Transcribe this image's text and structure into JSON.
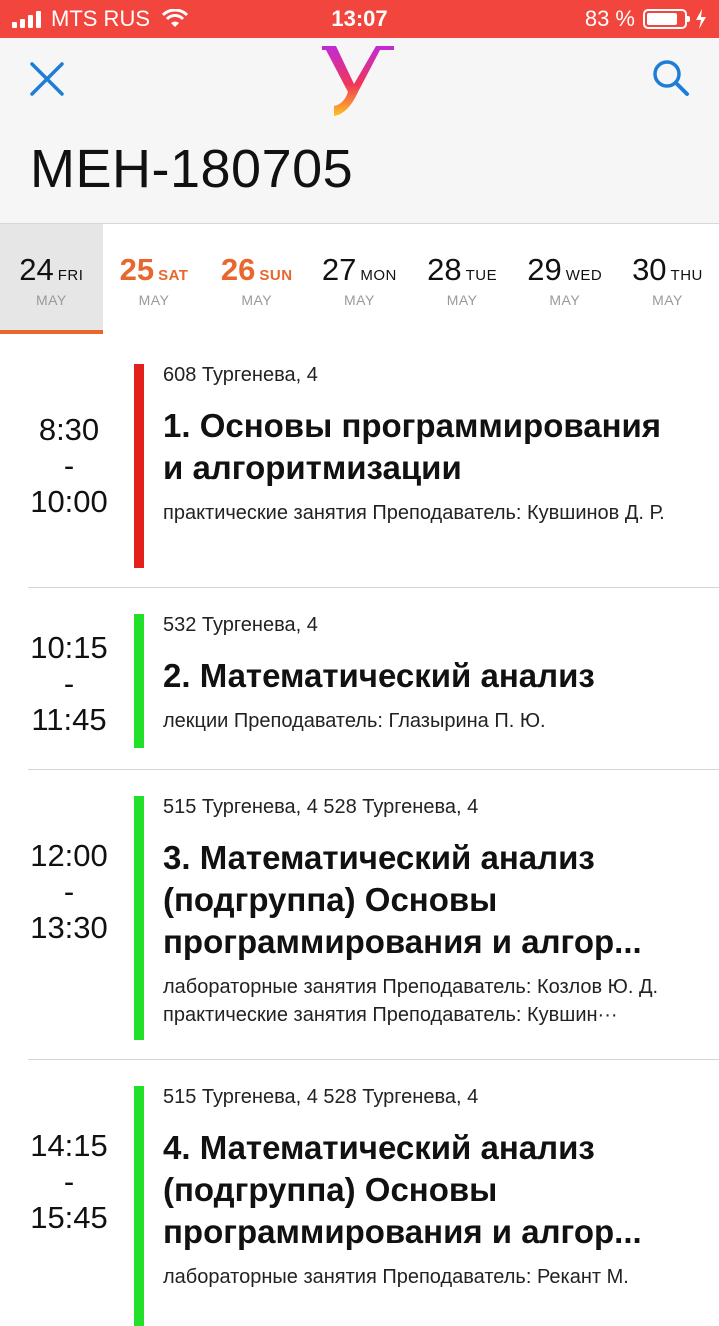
{
  "status": {
    "carrier": "MTS RUS",
    "time": "13:07",
    "battery_text": "83 %",
    "battery_level": 0.83
  },
  "header": {
    "title": "МЕН-180705",
    "icons": {
      "close": "close-icon",
      "search": "search-icon",
      "logo": "university-logo"
    }
  },
  "days": [
    {
      "num": "24",
      "wd": "FRI",
      "month": "MAY",
      "active": true,
      "weekend": false
    },
    {
      "num": "25",
      "wd": "SAT",
      "month": "MAY",
      "active": false,
      "weekend": true
    },
    {
      "num": "26",
      "wd": "SUN",
      "month": "MAY",
      "active": false,
      "weekend": true
    },
    {
      "num": "27",
      "wd": "MON",
      "month": "MAY",
      "active": false,
      "weekend": false
    },
    {
      "num": "28",
      "wd": "TUE",
      "month": "MAY",
      "active": false,
      "weekend": false
    },
    {
      "num": "29",
      "wd": "WED",
      "month": "MAY",
      "active": false,
      "weekend": false
    },
    {
      "num": "30",
      "wd": "THU",
      "month": "MAY",
      "active": false,
      "weekend": false
    }
  ],
  "colors": {
    "accent": "#e8672d",
    "statusbar": "#f2453d",
    "link_blue": "#1e7ed6",
    "bar_red": "#e3201b",
    "bar_green": "#22e02a"
  },
  "lessons": [
    {
      "start": "8:30",
      "dash": "-",
      "end": "10:00",
      "bar_color": "#e3201b",
      "room": "608 Тургенева, 4",
      "title": "1. Основы программирования и алгоритмизации",
      "sub": "практические занятия Преподаватель: Кувшинов Д. Р."
    },
    {
      "start": "10:15",
      "dash": "-",
      "end": "11:45",
      "bar_color": "#22e02a",
      "room": "532 Тургенева, 4",
      "title": "2. Математический анализ",
      "sub": "лекции Преподаватель: Глазырина П. Ю."
    },
    {
      "start": "12:00",
      "dash": "-",
      "end": "13:30",
      "bar_color": "#22e02a",
      "room": "515 Тургенева, 4 528 Тургенева, 4",
      "title": "3. Математический анализ (подгруппа) Основы программирования и алгор...",
      "sub": "лабораторные занятия Преподаватель: Козлов Ю. Д. практические занятия Преподаватель: Кувшин···"
    },
    {
      "start": "14:15",
      "dash": "-",
      "end": "15:45",
      "bar_color": "#22e02a",
      "room": "515 Тургенева, 4 528 Тургенева, 4",
      "title": "4. Математический анализ (подгруппа) Основы программирования и алгор...",
      "sub": "лабораторные занятия Преподаватель: Рекант М."
    }
  ]
}
